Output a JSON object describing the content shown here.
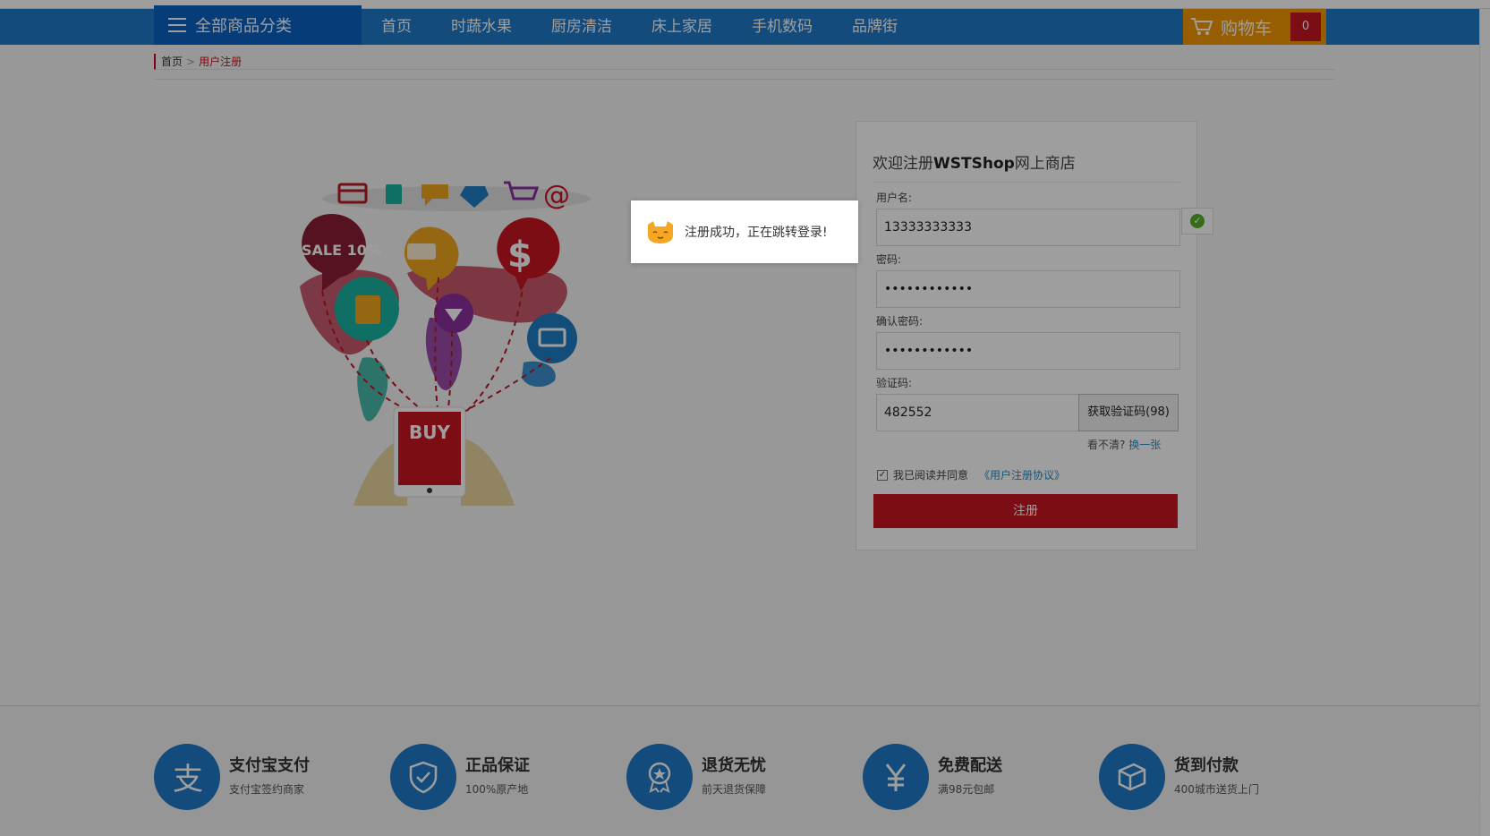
{
  "nav": {
    "category_label": "全部商品分类",
    "links": [
      "首页",
      "时蔬水果",
      "厨房清洁",
      "床上家居",
      "手机数码",
      "品牌街"
    ],
    "cart_label": "购物车",
    "cart_count": "0"
  },
  "breadcrumb": {
    "home": "首页",
    "sep": ">",
    "current": "用户注册"
  },
  "register": {
    "title_prefix": "欢迎注册",
    "title_brand": "WSTShop",
    "title_suffix": "网上商店",
    "username_label": "用户名:",
    "username_value": "13333333333",
    "password_label": "密码:",
    "password_value": "••••••••••••",
    "confirm_label": "确认密码:",
    "confirm_value": "••••••••••••",
    "code_label": "验证码:",
    "code_value": "482552",
    "get_code_label": "获取验证码(98)",
    "refresh_prefix": "看不清?",
    "refresh_link": "换一张",
    "agree_text": "我已阅读并同意",
    "agree_link": "《用户注册协议》",
    "submit_label": "注册"
  },
  "illustration": {
    "sale_text": "SALE 10%",
    "buy_text": "BUY"
  },
  "toast": {
    "message": "注册成功，正在跳转登录!"
  },
  "features": [
    {
      "title": "支付宝支付",
      "sub": "支付宝签约商家",
      "icon": "alipay-icon"
    },
    {
      "title": "正品保证",
      "sub": "100%原产地",
      "icon": "shield-icon"
    },
    {
      "title": "退货无忧",
      "sub": "前天退货保障",
      "icon": "badge-icon"
    },
    {
      "title": "免费配送",
      "sub": "满98元包邮",
      "icon": "yen-icon"
    },
    {
      "title": "货到付款",
      "sub": "400城市送货上门",
      "icon": "box-icon"
    }
  ],
  "colors": {
    "nav_blue": "#1f79c8",
    "category_blue": "#0b63c4",
    "cart_orange": "#f39800",
    "brand_red": "#c81523",
    "link_blue": "#2b8ec6"
  }
}
